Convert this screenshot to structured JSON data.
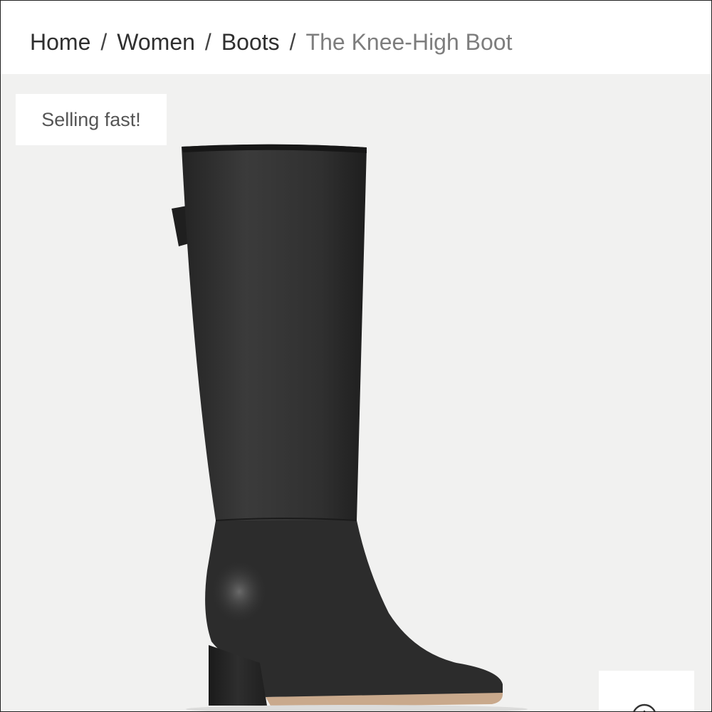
{
  "breadcrumb": {
    "items": [
      "Home",
      "Women",
      "Boots"
    ],
    "separator": "/",
    "current": "The Knee-High Boot"
  },
  "product": {
    "badge": "Selling fast!",
    "image_icon": "boot-image",
    "zoom_icon": "zoom-icon"
  },
  "colors": {
    "background": "#f1f1f0",
    "boot": "#2a2a2a",
    "text_current": "#7d7d7d"
  }
}
